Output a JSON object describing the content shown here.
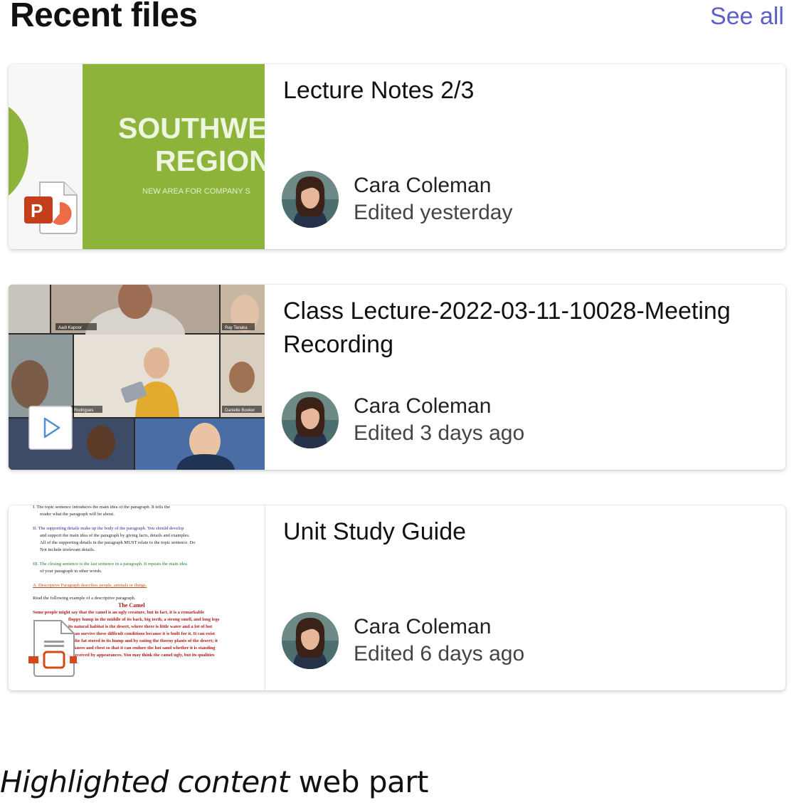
{
  "header": {
    "title": "Recent files",
    "see_all": "See all"
  },
  "files": [
    {
      "title": "Lecture Notes 2/3",
      "author": "Cara Coleman",
      "edited": "Edited yesterday",
      "type_icon": "powerpoint-icon",
      "thumbnail": {
        "line1": "SOUTHWE",
        "line2": "REGION",
        "line3": "NEW AREA FOR COMPANY S",
        "bg_color": "#8db33a"
      }
    },
    {
      "title": "Class Lecture-2022-03-11-10028-Meeting Recording",
      "author": "Cara Coleman",
      "edited": "Edited 3 days ago",
      "type_icon": "play-icon",
      "thumbnail": {
        "tag1": "Aadi Kapoor",
        "tag2": "Ray Tanaka",
        "tag3": "Rodrigues",
        "tag4": "Danielle Booker"
      }
    },
    {
      "title": "Unit Study Guide",
      "author": "Cara Coleman",
      "edited": "Edited 6 days ago",
      "type_icon": "slides-icon",
      "thumbnail": {
        "l1": "I.  The topic sentence introduces the main idea of the paragraph. It tells the",
        "l2": "reader what the paragraph will be about.",
        "l3": "II.  The supporting details make up the body of the paragraph. You should develop",
        "l4": "and support the main idea of the paragraph by giving facts, details and examples.",
        "l5": "All of the supporting details in the paragraph MUST relate to the topic sentence. Do",
        "l6": "Not include irrelevant details.",
        "l7": "III.  The closing sentence is the last sentence in a paragraph. It repeats the main idea",
        "l8": "of your paragraph in other words.",
        "l9": "A. Descriptive Paragraph  describes people, animals or things.",
        "l10": "Read the following example of a descriptive paragraph.",
        "l11": "The Camel",
        "l12": "Some people might say that the camel is an ugly creature, but in fact, it is a remarkable",
        "l13": "floppy hump in the middle of its back, big teeth, a strong smell, and long legs",
        "l14": "its natural habitat is the desert, where there is little water and a lot of hot",
        "l15": "el can survive these difficult conditions because it is built for it. It can exist",
        "l16": "the fat stored in its hump and by eating the thorny plants of the desert; it",
        "l17": "knees and chest so that it can endure the hot sand whether it is standing",
        "l18": "sitting. Don't be deceived by appearances. You may think the camel ugly, but its qualities",
        "l19": "go far beyond its looks."
      }
    }
  ],
  "caption": {
    "italic": "Highlighted content",
    "rest": " web part"
  },
  "colors": {
    "accent": "#5b5fc7",
    "powerpoint": "#c43e1c",
    "thumb_green": "#8db33a"
  }
}
